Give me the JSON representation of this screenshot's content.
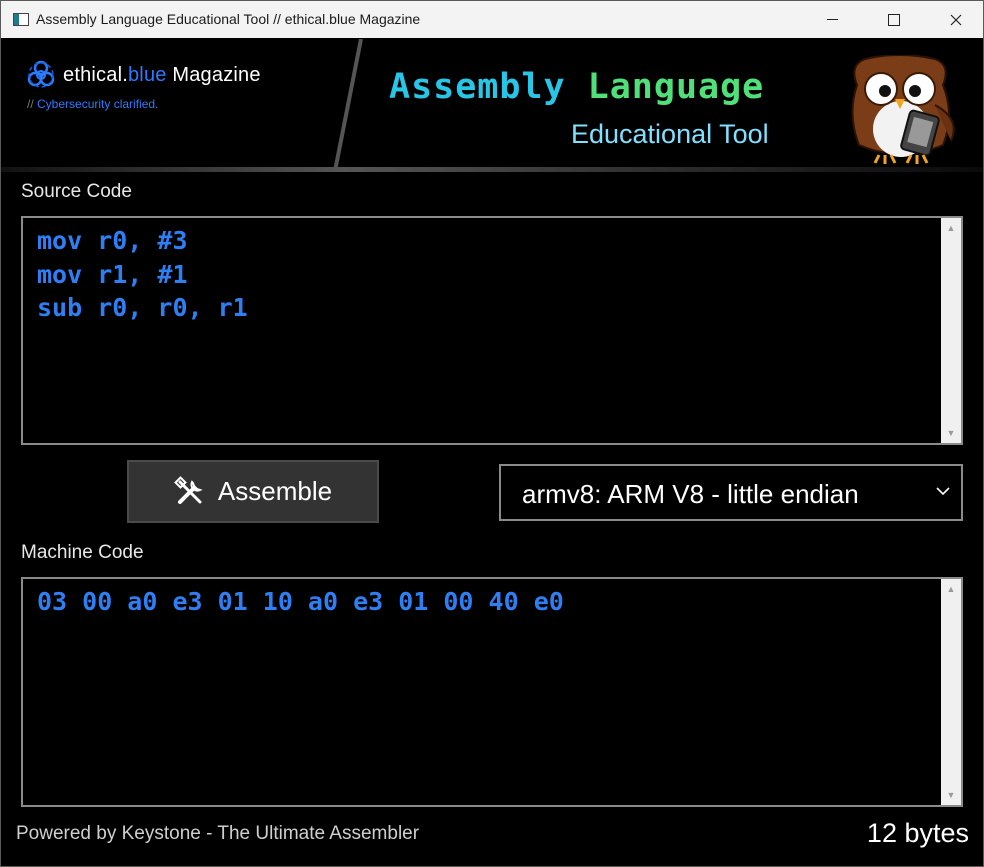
{
  "window": {
    "title": "Assembly Language Educational Tool // ethical.blue Magazine"
  },
  "banner": {
    "brand_prefix": "ethical.",
    "brand_blue": "blue",
    "brand_suffix": " Magazine",
    "tagline_slash": "//",
    "tagline": " Cybersecurity clarified.",
    "title_word1": "Assembly",
    "title_word2": "Language",
    "subtitle": "Educational Tool"
  },
  "source": {
    "label": "Source Code",
    "code": "mov r0, #3\nmov r1, #1\nsub r0, r0, r1"
  },
  "controls": {
    "assemble_label": "Assemble",
    "arch_selected": "armv8: ARM V8 - little endian"
  },
  "machine": {
    "label": "Machine Code",
    "bytes": "03 00 a0 e3 01 10 a0 e3 01 00 40 e0"
  },
  "footer": {
    "powered_by": "Powered by Keystone - The Ultimate Assembler",
    "size": "12 bytes"
  },
  "colors": {
    "code_blue": "#2f7ff4",
    "brand_blue": "#2b7bff",
    "title_cyan": "#27c6e6",
    "title_green": "#4fe07a"
  },
  "icons": [
    "app-icon",
    "biohazard-icon",
    "owl-mascot",
    "tools-icon",
    "chevron-down-icon",
    "scroll-up-icon",
    "scroll-down-icon"
  ]
}
